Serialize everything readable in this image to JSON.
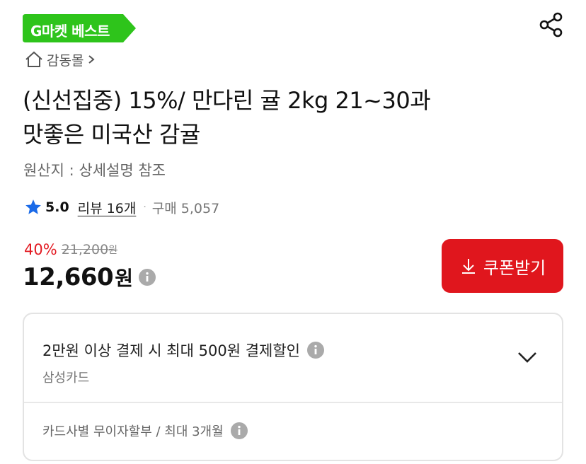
{
  "badge": {
    "label": "G마켓 베스트",
    "color": "#2ec41b"
  },
  "breadcrumb": {
    "label": "감동몰",
    "icon": "home-icon"
  },
  "share": {
    "icon": "share-icon"
  },
  "product": {
    "title_line1": "(신선집중) 15%/ 만다린 귤 2kg 21~30과",
    "title_line2": "맛좋은 미국산 감귤",
    "origin": "원산지 : 상세설명 참조"
  },
  "rating": {
    "score": "5.0",
    "reviews": "리뷰 16개",
    "separator": "·",
    "purchases": "구매 5,057",
    "star_color": "#1a6ae8"
  },
  "pricing": {
    "discount": "40%",
    "original_price": "21,200",
    "original_unit": "원",
    "price": "12,660",
    "price_unit": "원",
    "discount_color": "#e31b23"
  },
  "coupon_button": {
    "label": "쿠폰받기",
    "icon": "download-icon",
    "color": "#e0161d"
  },
  "card_benefit": {
    "title": "2만원 이상 결제 시 최대 500원 결제할인",
    "card_name": "삼성카드",
    "installment": "카드사별 무이자할부 / 최대 3개월"
  }
}
